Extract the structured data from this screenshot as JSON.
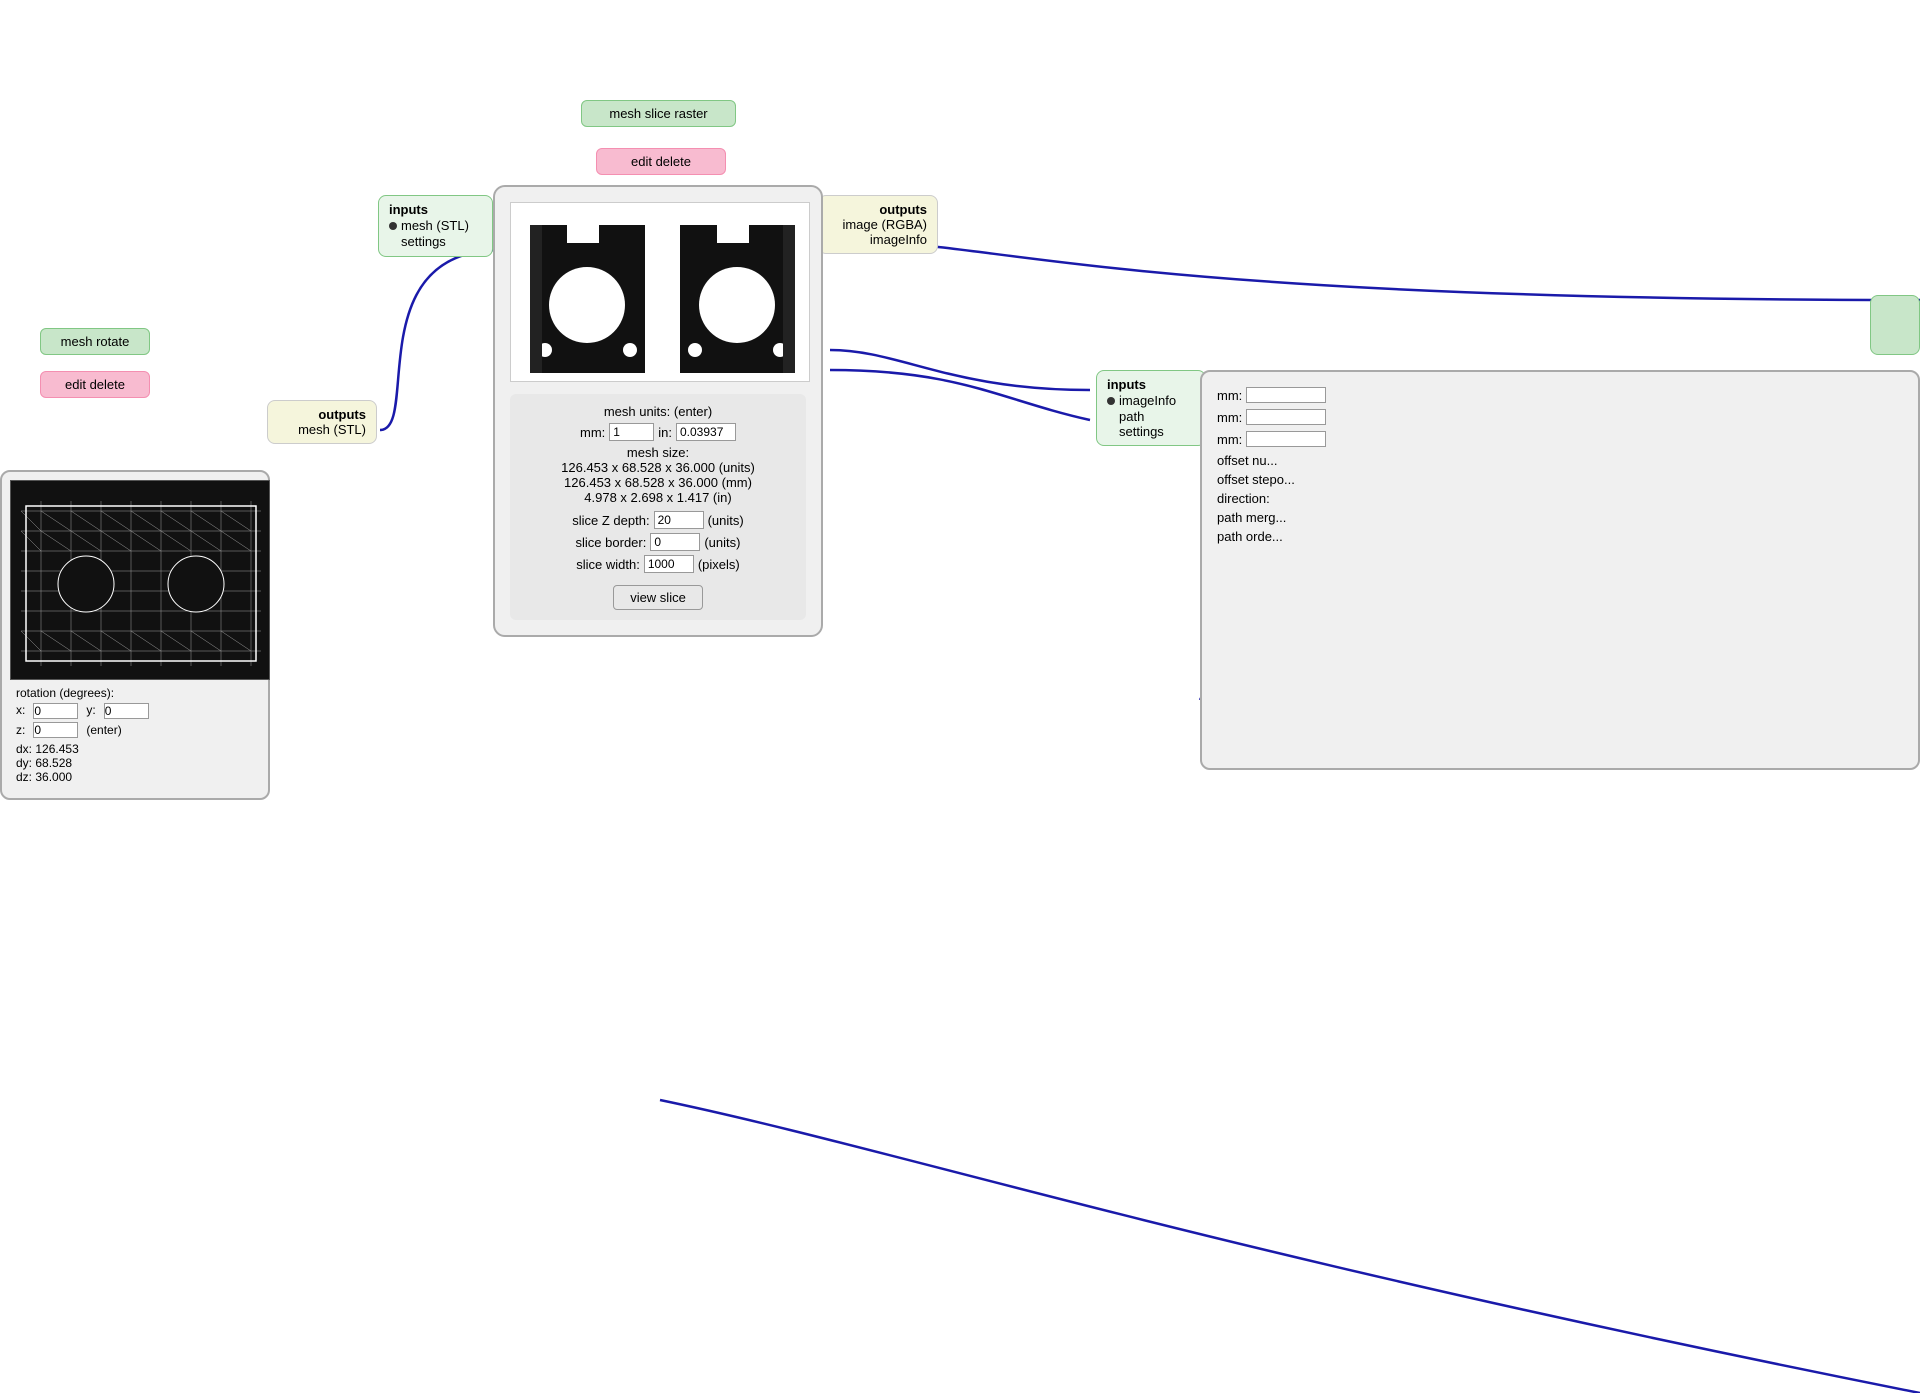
{
  "nodes": {
    "meshSliceRaster": {
      "label": "mesh slice raster",
      "editDelete": "edit delete",
      "inputs": {
        "title": "inputs",
        "items": [
          "mesh (STL)",
          "settings"
        ]
      },
      "outputs": {
        "title": "outputs",
        "items": [
          "image (RGBA)",
          "imageInfo"
        ]
      },
      "settings": {
        "meshUnitsLabel": "mesh units: (enter)",
        "mmLabel": "mm:",
        "mmValue": "1",
        "inLabel": "in:",
        "inValue": "0.03937",
        "meshSizeLabel": "mesh size:",
        "meshSize1": "126.453 x 68.528 x 36.000 (units)",
        "meshSize2": "126.453 x 68.528 x 36.000 (mm)",
        "meshSize3": "4.978 x 2.698 x 1.417 (in)",
        "sliceZDepthLabel": "slice Z depth:",
        "sliceZDepthValue": "20",
        "sliceZDepthUnits": "(units)",
        "sliceBorderLabel": "slice border:",
        "sliceBorderValue": "0",
        "sliceBorderUnits": "(units)",
        "sliceWidthLabel": "slice width:",
        "sliceWidthValue": "1000",
        "sliceWidthUnits": "(pixels)",
        "viewSliceButton": "view slice"
      }
    },
    "meshRotate": {
      "label": "mesh rotate",
      "editDelete": "edit delete",
      "outputs": {
        "title": "outputs",
        "items": [
          "mesh (STL)"
        ]
      },
      "settings": {
        "rotationLabel": "rotation (degrees):",
        "xLabel": "x:",
        "xValue": "0",
        "yLabel": "y:",
        "yValue": "0",
        "zLabel": "z:",
        "zValue": "0",
        "enterLabel": "(enter)",
        "dxLabel": "dx:",
        "dxValue": "126.453",
        "dyLabel": "dy:",
        "dyValue": "68.528",
        "dzLabel": "dz:",
        "dzValue": "36.000"
      }
    },
    "rightNode": {
      "inputs": {
        "title": "inputs",
        "items": [
          "imageInfo",
          "path",
          "settings"
        ]
      },
      "mmRows": [
        "mm:",
        "mm:",
        "mm:"
      ],
      "otherRows": [
        "offset nu...",
        "offset stepo...",
        "direction:",
        "path merg...",
        "path orde..."
      ]
    }
  },
  "colors": {
    "connectionLine": "#1a1aaa",
    "greenLabel": "#c8e6c9",
    "pinkLabel": "#f8bbd0",
    "yellowBox": "#f5f5dc"
  }
}
